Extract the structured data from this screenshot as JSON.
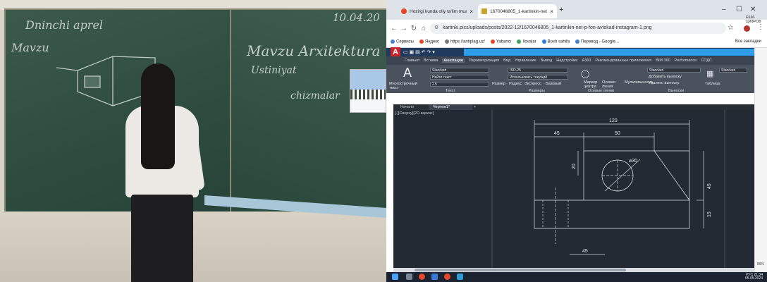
{
  "photo": {
    "chalk_date": "10.04.20",
    "chalk_line1": "Dninchi aprel",
    "chalk_line2": "Mavzu",
    "chalk_line3": "Mavzu Arxitektura",
    "chalk_line4": "Ustiniyat",
    "chalk_line5": "chizmalar"
  },
  "browser": {
    "tabs": [
      {
        "label": "Hozirgi kunda oliy ta'lim muas",
        "active": false,
        "icon": "opera-favicon"
      },
      {
        "label": "1670046805_1-kartinkin-net-p",
        "active": true,
        "icon": "image-favicon"
      }
    ],
    "new_tab": "+",
    "url": "kartinki.pics/uploads/posts/2022-12/1670046805_1-kartinkin-net-p-fon-avtokad-instagram-1.png",
    "bookmarks": [
      {
        "label": "Сервисы",
        "color": "#4a7fd0"
      },
      {
        "label": "Яндекс",
        "color": "#e8462a"
      },
      {
        "label": "https://antiplag.uz/",
        "color": "#777777"
      },
      {
        "label": "Yabancı",
        "color": "#e8462a"
      },
      {
        "label": "Ilovalar",
        "color": "#3ba55c"
      },
      {
        "label": "Bosh sahifa",
        "color": "#2b7bd8"
      },
      {
        "label": "Перевод - Google...",
        "color": "#4a7fd0"
      }
    ],
    "all_bookmarks": "Все закладки",
    "side_text": "ЕШИ-ЦИФРОВ"
  },
  "cad": {
    "logo": "A",
    "tabs": [
      "Главная",
      "Вставка",
      "Аннотации",
      "Параметризация",
      "Вид",
      "Управление",
      "Вывод",
      "Надстройки",
      "A360",
      "Рекомендованные приложения",
      "BIM 360",
      "Performance",
      "СПДС"
    ],
    "active_tab": "Аннотации",
    "ribbon": {
      "text_label": "Многострочный текст",
      "style1": "Standard",
      "find_text": "Найти текст",
      "height": "2.5",
      "dim_style": "ISO-25",
      "use_current": "Использовать текущий",
      "size_label": "Размер",
      "radius": "Радиус",
      "express": "Экспресс",
      "baseline": "Базовый",
      "center_mark": "Маркер центра",
      "centerline": "Осевая линия",
      "multileader": "Мультивыноска",
      "ml_style": "Standard",
      "add_leader": "Добавить выноску",
      "remove_leader": "Удалить выноску",
      "table": "Таблица",
      "table_style": "Standard",
      "panel_text": "Текст",
      "panel_dims": "Размеры",
      "panel_center": "Осевые линии",
      "panel_leaders": "Выноски"
    },
    "doc_tabs": [
      "Начало",
      "Чертеж1*"
    ],
    "view_label": "[-][Сверху][2D-каркас]",
    "dimensions": [
      "120",
      "45",
      "50",
      "20",
      "⌀30",
      "45",
      "15",
      "45"
    ]
  },
  "taskbar": {
    "lang": "РУС",
    "time": "21:34",
    "date": "05.05.2024",
    "percent": "89%"
  }
}
